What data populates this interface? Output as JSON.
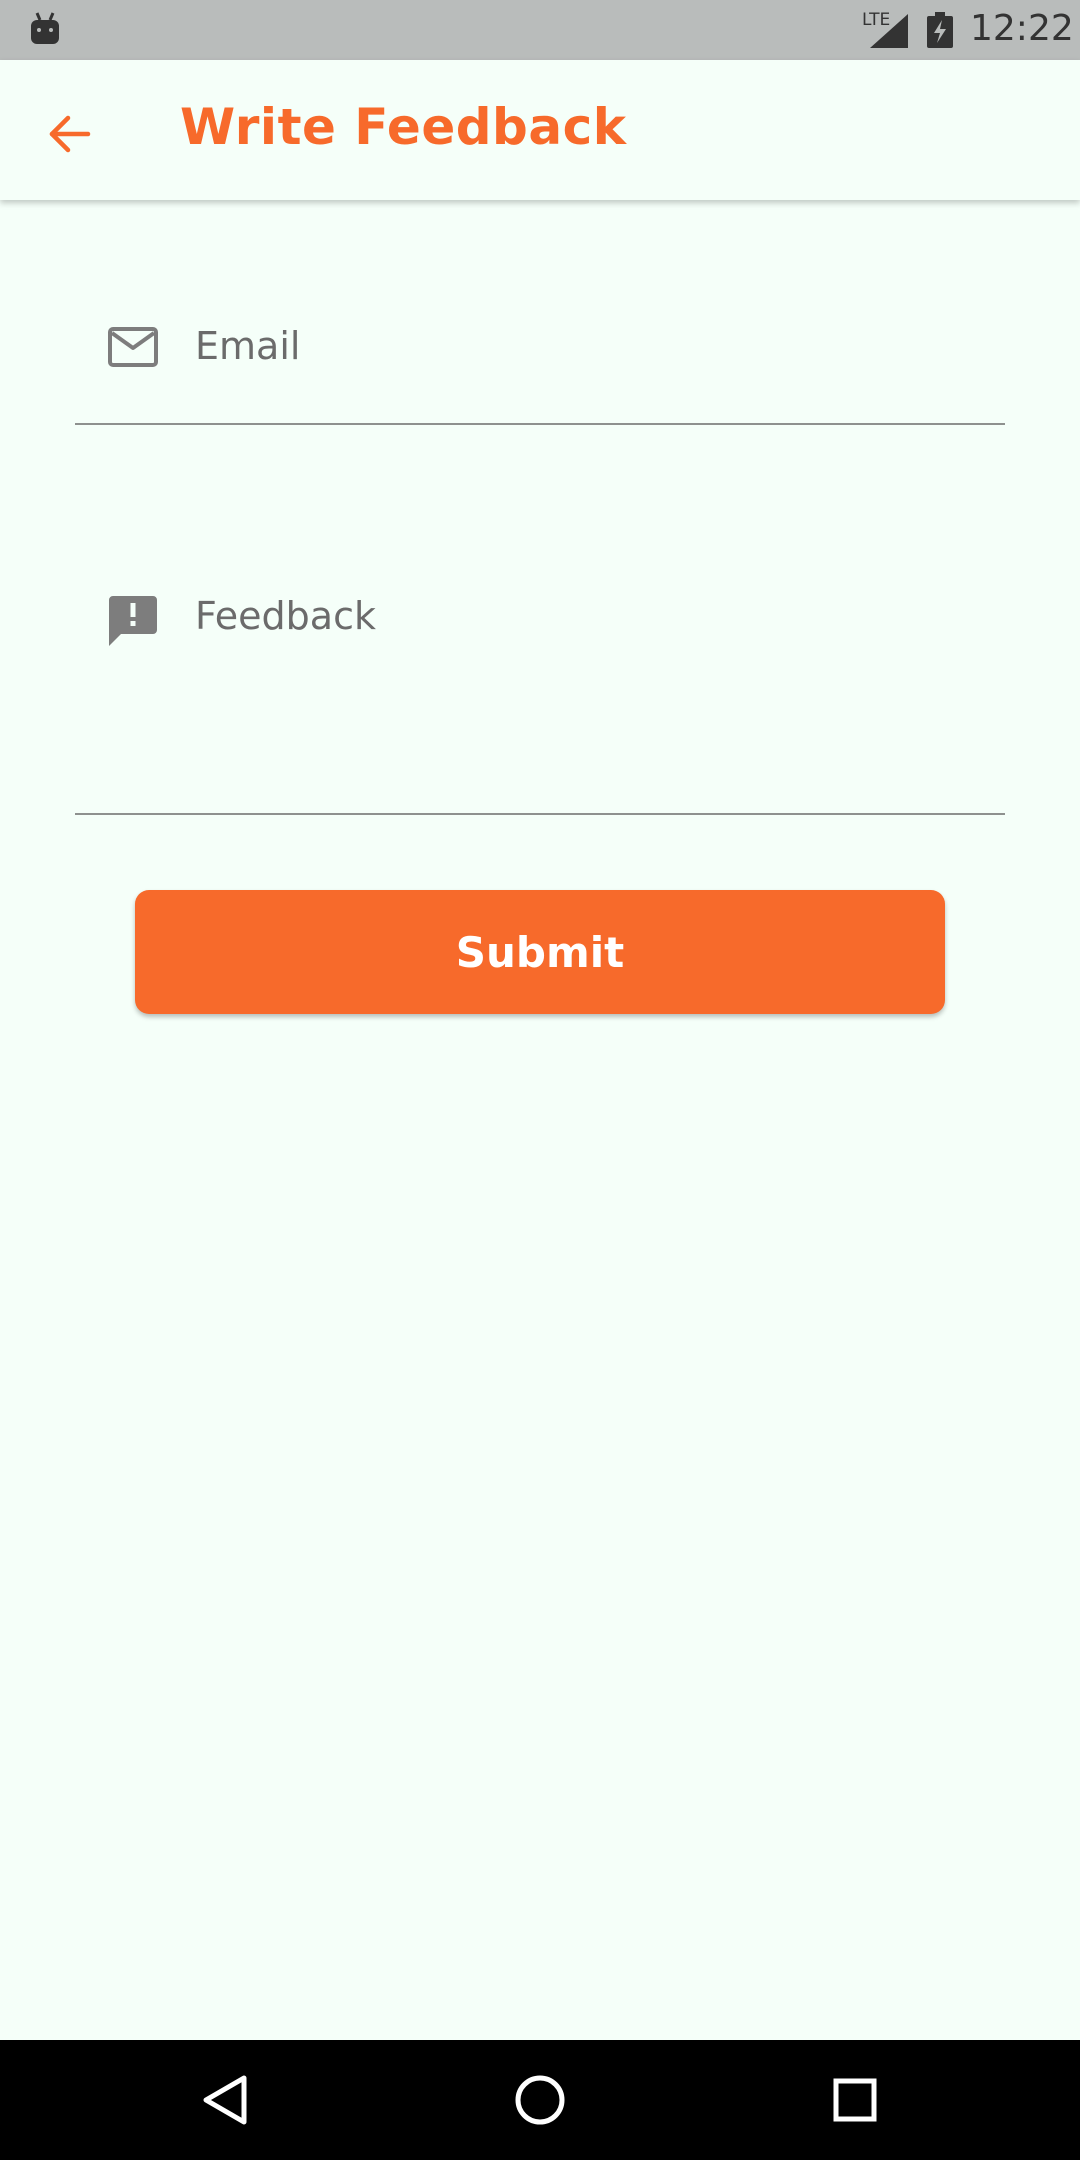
{
  "status_bar": {
    "network_label": "LTE",
    "time": "12:22",
    "icons": [
      "android-icon",
      "signal-icon",
      "battery-charging-icon"
    ]
  },
  "app_bar": {
    "title": "Write Feedback",
    "back_icon": "arrow-back-icon"
  },
  "form": {
    "email": {
      "placeholder": "Email",
      "icon": "mail-icon"
    },
    "feedback": {
      "placeholder": "Feedback",
      "icon": "feedback-icon"
    },
    "submit_label": "Submit"
  },
  "nav_bar": {
    "icons": [
      "nav-back-icon",
      "nav-home-icon",
      "nav-recents-icon"
    ]
  },
  "colors": {
    "accent": "#f76a2b",
    "background": "#f5fff9",
    "status_bar": "#b9bcbb",
    "field_text": "#6b6b6b",
    "underline": "#8e918f"
  }
}
